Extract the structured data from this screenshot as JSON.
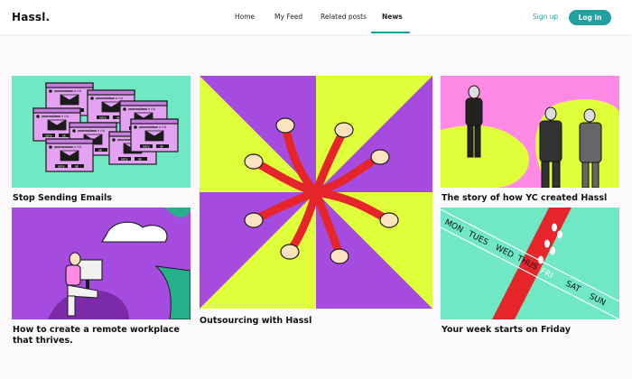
{
  "header": {
    "logo": "Hassl.",
    "nav": [
      "Home",
      "My Feed",
      "Related posts",
      "News"
    ],
    "active_nav": "News",
    "signup_label": "Sign up",
    "login_label": "Log in"
  },
  "articles": [
    {
      "title": "Stop Sending Emails",
      "illustration": {
        "popup_text": "your mailbox is full",
        "button_left": "retry",
        "button_right": "ok"
      }
    },
    {
      "title": "Outsourcing with Hassl"
    },
    {
      "title": "The story of how YC created Hassl"
    },
    {
      "title": "How to create a remote workplace that thrives."
    },
    {
      "title": "Your week starts on Friday",
      "illustration": {
        "days": [
          "MON",
          "TUES",
          "WED",
          "THUS",
          "FRI",
          "SAT",
          "SUN"
        ]
      }
    }
  ],
  "colors": {
    "accent": "#22a0a0",
    "mint": "#6fe8c3",
    "purple": "#a54be0",
    "lime": "#dfff3a",
    "pink": "#ff8ae6",
    "red": "#e5252a"
  }
}
